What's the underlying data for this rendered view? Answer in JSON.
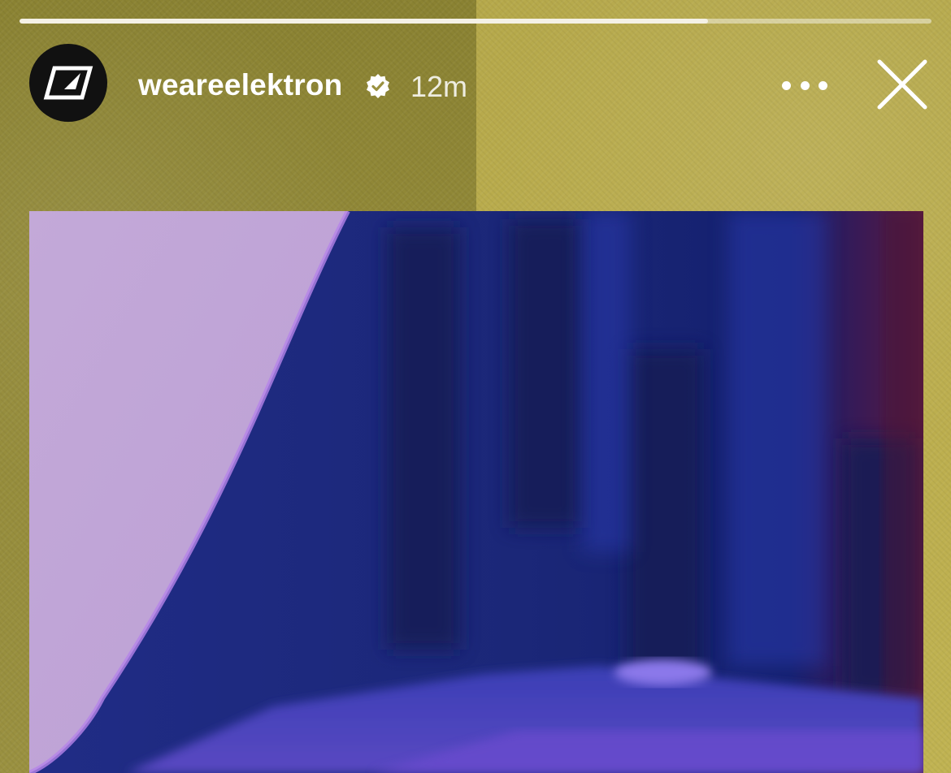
{
  "story": {
    "progress": 0.755
  },
  "header": {
    "username": "weareelektron",
    "verified": true,
    "timestamp": "12m",
    "avatar_icon": "elektron-logo-icon",
    "more_icon": "more-horizontal-icon",
    "close_icon": "close-icon"
  },
  "colors": {
    "background_left": "#948b3a",
    "background_right": "#bcae4e",
    "text": "#ffffff",
    "media_blue": "#1f2a80",
    "media_lilac": "#c4a8d9",
    "media_purple": "#7a4fd0"
  }
}
